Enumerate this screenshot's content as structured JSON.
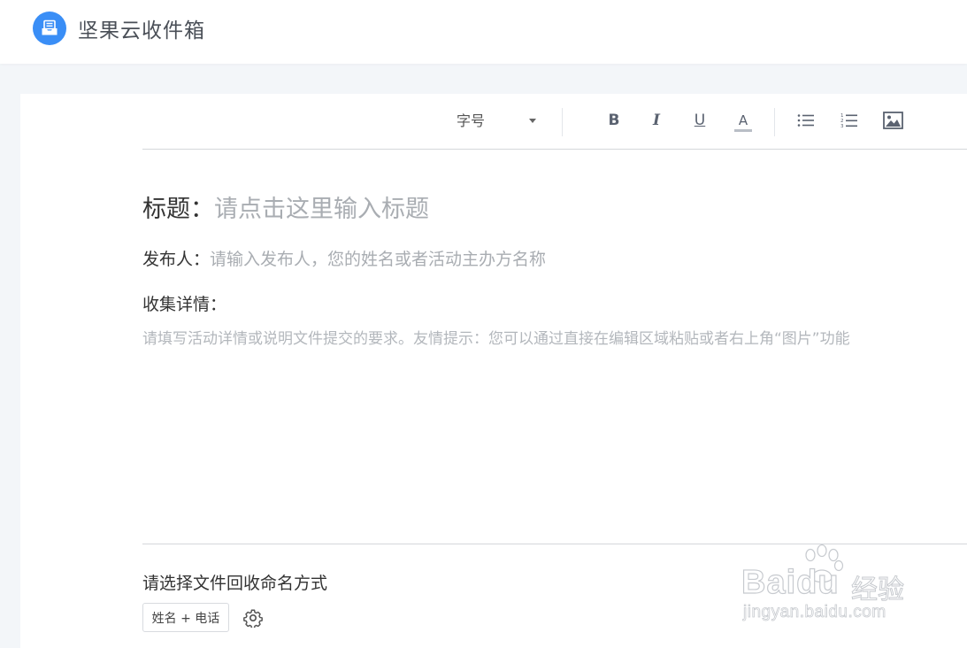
{
  "header": {
    "app_title": "坚果云收件箱",
    "logo_icon": "inbox-tray-icon",
    "logo_color": "#3a8ef6"
  },
  "toolbar": {
    "font_size_label": "字号",
    "bold_glyph": "B",
    "italic_glyph": "I",
    "underline_glyph": "U",
    "font_color_glyph": "A",
    "icons": [
      "bold-icon",
      "italic-icon",
      "underline-icon",
      "font-color-icon",
      "bullet-list-icon",
      "numbered-list-icon",
      "image-icon"
    ]
  },
  "form": {
    "title_label": "标题：",
    "title_placeholder": "请点击这里输入标题",
    "publisher_label": "发布人：",
    "publisher_placeholder": "请输入发布人，您的姓名或者活动主办方名称",
    "details_label": "收集详情：",
    "details_placeholder": "请填写活动详情或说明文件提交的要求。友情提示：您可以通过直接在编辑区域粘贴或者右上角“图片”功能",
    "naming_label": "请选择文件回收命名方式",
    "naming_value": "姓名 + 电话"
  },
  "watermark": {
    "brand": "Baidu",
    "brand_cn": "经验",
    "url": "jingyan.baidu.com"
  }
}
